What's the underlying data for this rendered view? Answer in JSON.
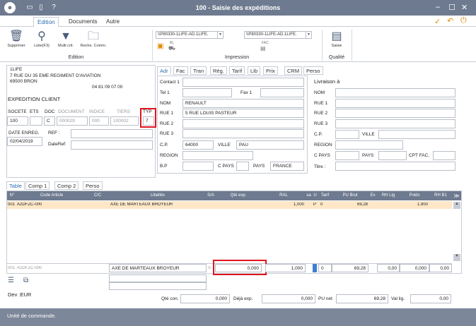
{
  "window": {
    "title": "100 - Saisie des expéditions"
  },
  "ribbon_tabs": [
    "Edition",
    "Documents",
    "Autre"
  ],
  "ribbon": {
    "delete_label": "Supprimer",
    "list_label": "Liste(F3)",
    "multicrit_label": "Multi crit.",
    "comm_label": "Reche. Comm.",
    "group_edition": "Edition",
    "group_impression": "Impression",
    "group_qualite": "Qualité",
    "printer1": "\\\\P80330-1LIFE-AD.1LIFE.",
    "printer2": "\\\\P80330-1LIFE-AD.1LIFE.",
    "bl_label": "BL",
    "fac_label": "FAC",
    "saisie_label": "Saisie"
  },
  "company": {
    "name": "1LIFE",
    "address1": "7 RUE DU 35 EME REGIMENT D'AVIATION",
    "address2": "69500 BRON",
    "phone": "04 81 09 07 00"
  },
  "doc": {
    "heading": "EXPEDITION CLIENT",
    "labels": {
      "societe": "SOCETE",
      "ets": "ETS",
      "doc": "DOC",
      "document": "DOCUMENT",
      "indice": "INDICE",
      "tiers": "TIERS",
      "typ": "TYP",
      "date": "DATE ENREG.",
      "ref": "REF :",
      "dateref": "DateRef:"
    },
    "values": {
      "societe": "100",
      "ets": "",
      "doc": "C",
      "document": "000029",
      "indice": "000",
      "tiers": "100002",
      "typ": "7",
      "date": "02/04/2019",
      "ref": "",
      "dateref": ""
    }
  },
  "addr_tabs": [
    "Adr",
    "Fac",
    "Tran",
    "Rég.",
    "Tarif",
    "Lib",
    "Prix",
    "CRM",
    "Perso"
  ],
  "addr": {
    "labels": {
      "contact1": "Contact 1",
      "tel1": "Tel 1",
      "fax1": "Fax 1",
      "nom": "NOM",
      "rue1": "RUE 1",
      "rue2": "RUE 2",
      "rue3": "RUE 3",
      "cp": "C.P.",
      "ville": "VILLE",
      "region": "REGION",
      "bp": "B.P",
      "cpays": "C PAYS",
      "pays": "PAYS"
    },
    "values": {
      "nom": "RENAULT",
      "rue1": "5 RUE LOUIS PASTEUR",
      "cp": "64000",
      "ville": "PAU",
      "pays": "FRANCE"
    }
  },
  "livraison": {
    "title": "Livraison à",
    "labels": {
      "nom": "NOM",
      "rue1": "RUE 1",
      "rue2": "RUE 2",
      "rue3": "RUE 3",
      "cp": "C.P.",
      "ville": "VILLE",
      "region": "REGION",
      "cpays": "C PAYS",
      "pays": "PAYS",
      "cptfac": "CPT FAC.",
      "titre": "Titre :"
    }
  },
  "grid_tabs": [
    "Table",
    "Comp 1",
    "Comp 2",
    "Perso"
  ],
  "grid": {
    "headers": [
      "N°",
      "Code Article",
      "C/C",
      "Libellés",
      "S/A",
      "Qté exp.",
      "RAL",
      "sa",
      "U",
      "Tarif",
      "PU Brut",
      "Ex",
      "RH Lig",
      "Poids",
      "RH B1"
    ],
    "row": {
      "n": "001",
      "code": "A2DFZC-000",
      "lib": "AXE DE MARTEAUX BROYEUR",
      "qte": "",
      "ral": "1,000",
      "u": "P",
      "tarif": "0",
      "pu": "69,28",
      "poids": "1,900"
    },
    "edit": {
      "n": "001",
      "code": "A2DFZC-000",
      "lib": "AXE DE MARTEAUX BROYEUR",
      "sa": "S",
      "qte": "0,000",
      "ral": "1,000",
      "tarif": "0",
      "pu": "69,28",
      "rhlig": "0,00",
      "poids": "0,000",
      "rhb1": "0,00"
    }
  },
  "footer": {
    "dev": "Dev :EUR",
    "qte_con_label": "Qté con.",
    "qte_con": "0,000",
    "deja_label": "Déjà exp.",
    "deja": "0,000",
    "punet_label": "PU net",
    "punet": "69,28",
    "vallig_label": "Val lig.",
    "vallig": "0,00"
  },
  "status": "Unité de commande."
}
